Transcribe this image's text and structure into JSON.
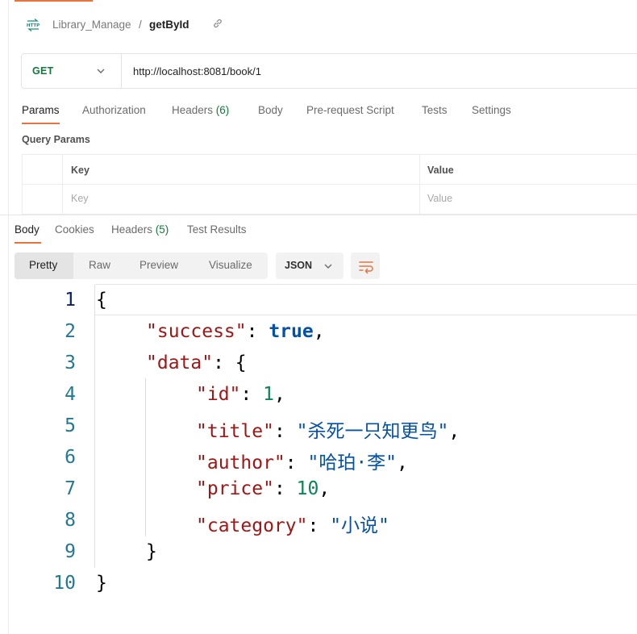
{
  "header": {
    "breadcrumb": [
      "Library_Manage",
      "getById"
    ],
    "separator": "/"
  },
  "request": {
    "method": "GET",
    "url": "http://localhost:8081/book/1",
    "method_color": "#107a3b"
  },
  "request_tabs": [
    {
      "label": "Params",
      "count": "",
      "active": true
    },
    {
      "label": "Authorization",
      "count": ""
    },
    {
      "label": "Headers",
      "count": "(6)"
    },
    {
      "label": "Body",
      "count": ""
    },
    {
      "label": "Pre-request Script",
      "count": ""
    },
    {
      "label": "Tests",
      "count": ""
    },
    {
      "label": "Settings",
      "count": ""
    }
  ],
  "query_params": {
    "title": "Query Params",
    "columns": [
      "Key",
      "Value"
    ],
    "placeholders": {
      "key": "Key",
      "value": "Value"
    }
  },
  "response_tabs": [
    {
      "label": "Body",
      "active": true
    },
    {
      "label": "Cookies"
    },
    {
      "label": "Headers",
      "count": "(5)"
    },
    {
      "label": "Test Results"
    }
  ],
  "view_modes": [
    "Pretty",
    "Raw",
    "Preview",
    "Visualize"
  ],
  "active_view": "Pretty",
  "format": "JSON",
  "accent_color": "#e8733d",
  "code": {
    "line_numbers": [
      "1",
      "2",
      "3",
      "4",
      "5",
      "6",
      "7",
      "8",
      "9",
      "10"
    ],
    "open_brace": "{",
    "close_brace": "}",
    "success_key": "\"success\"",
    "success_val": "true",
    "data_key": "\"data\"",
    "id_key": "\"id\"",
    "id_val": "1",
    "title_key": "\"title\"",
    "title_val": "\"杀死一只知更鸟\"",
    "author_key": "\"author\"",
    "author_val": "\"哈珀·李\"",
    "price_key": "\"price\"",
    "price_val": "10",
    "category_key": "\"category\"",
    "category_val": "\"小说\"",
    "colon": ": ",
    "comma": ","
  },
  "icons": {
    "http": "http-request-icon",
    "link": "link-icon",
    "chevron": "chevron-down-icon",
    "wrap": "wrap-lines-icon"
  }
}
